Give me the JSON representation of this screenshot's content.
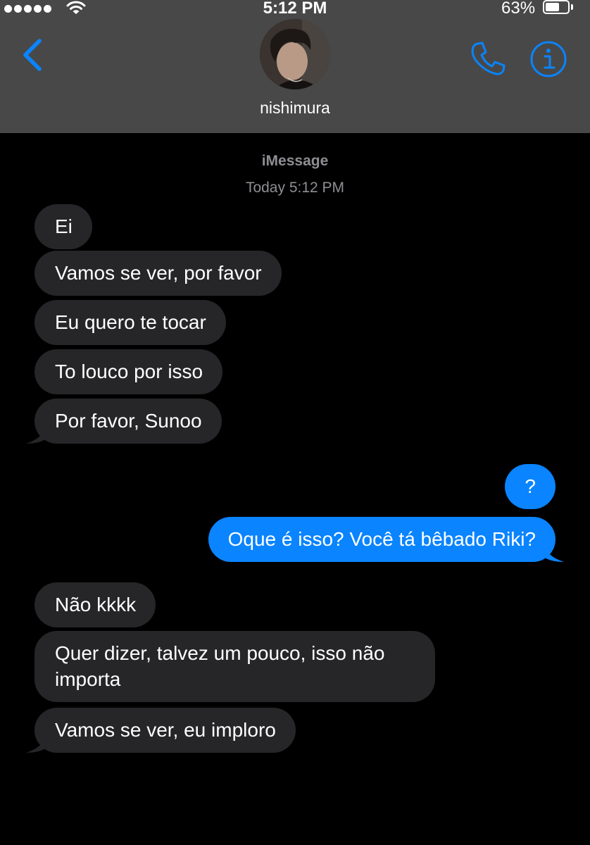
{
  "status_bar": {
    "time": "5:12 PM",
    "battery_percent": "63%",
    "battery_level": 0.63,
    "signal_icon": "signal-dots-icon",
    "wifi_icon": "wifi-icon"
  },
  "header": {
    "contact_name": "nishimura",
    "back_icon": "chevron-left-icon",
    "call_icon": "phone-icon",
    "info_icon": "info-icon",
    "accent_color": "#0a84ff"
  },
  "conversation": {
    "service": "iMessage",
    "timestamp": "Today 5:12 PM",
    "messages": [
      {
        "sender": "contact",
        "text": "Ei"
      },
      {
        "sender": "contact",
        "text": "Vamos se ver, por favor"
      },
      {
        "sender": "contact",
        "text": "Eu quero te tocar"
      },
      {
        "sender": "contact",
        "text": "To louco por isso"
      },
      {
        "sender": "contact",
        "text": "Por favor, Sunoo"
      },
      {
        "sender": "me",
        "text": "?"
      },
      {
        "sender": "me",
        "text": "Oque é isso? Você tá bêbado Riki?"
      },
      {
        "sender": "contact",
        "text": "Não kkkk"
      },
      {
        "sender": "contact",
        "text": "Quer dizer, talvez um pouco, isso não importa"
      },
      {
        "sender": "contact",
        "text": "Vamos se ver, eu imploro"
      }
    ]
  },
  "colors": {
    "header_bg": "#484848",
    "incoming_bubble": "#262628",
    "outgoing_bubble": "#0a84ff",
    "background": "#000000",
    "meta_text": "#8e8e93"
  }
}
